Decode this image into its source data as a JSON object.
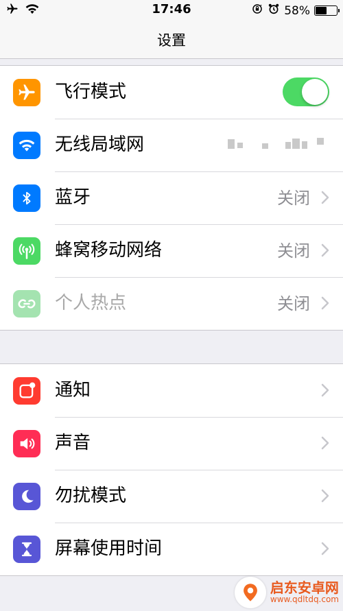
{
  "status_bar": {
    "time": "17:46",
    "battery_text": "58%",
    "battery_level": 0.58,
    "icons": [
      "airplane-icon",
      "wifi-icon",
      "orientation-lock-icon",
      "alarm-icon",
      "battery-icon"
    ]
  },
  "nav": {
    "title": "设置"
  },
  "groups": [
    {
      "rows": [
        {
          "label": "飞行模式",
          "icon": "airplane-icon",
          "icon_color": "#ff9500",
          "control": "toggle",
          "toggle_on": true
        },
        {
          "label": "无线局域网",
          "icon": "wifi-icon",
          "icon_color": "#007aff",
          "value_obscured": true
        },
        {
          "label": "蓝牙",
          "icon": "bluetooth-icon",
          "icon_color": "#007aff",
          "value": "关闭"
        },
        {
          "label": "蜂窝移动网络",
          "icon": "cellular-antenna-icon",
          "icon_color": "#4cd964",
          "value": "关闭"
        },
        {
          "label": "个人热点",
          "icon": "hotspot-link-icon",
          "icon_color": "#a4e3b0",
          "value": "关闭",
          "disabled": true
        }
      ]
    },
    {
      "rows": [
        {
          "label": "通知",
          "icon": "notifications-icon",
          "icon_color": "#ff3b30"
        },
        {
          "label": "声音",
          "icon": "speaker-icon",
          "icon_color": "#ff2d55"
        },
        {
          "label": "勿扰模式",
          "icon": "moon-icon",
          "icon_color": "#5856d6"
        },
        {
          "label": "屏幕使用时间",
          "icon": "hourglass-icon",
          "icon_color": "#5856d6"
        }
      ]
    }
  ],
  "watermark": {
    "name": "启东安卓网",
    "url": "www.qdltdq.com",
    "color": "#e85a1f"
  }
}
